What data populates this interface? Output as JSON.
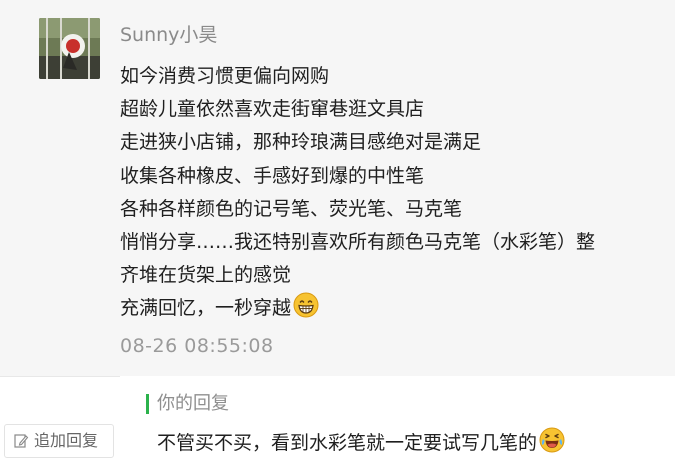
{
  "post": {
    "username": "Sunny小昊",
    "avatar_icon": "avatar-photo",
    "lines": [
      "如今消费习惯更偏向网购",
      "超龄儿童依然喜欢走街窜巷逛文具店",
      "走进狭小店铺，那种玲琅满目感绝对是满足",
      "收集各种橡皮、手感好到爆的中性笔",
      "各种各样颜色的记号笔、荧光笔、马克笔",
      "悄悄分享……我还特别喜欢所有颜色马克笔（水彩笔）整",
      "齐堆在货架上的感觉",
      "充满回忆，一秒穿越"
    ],
    "last_line_emoji": "grinning-face-emoji",
    "timestamp": "08-26 08:55:08"
  },
  "reply": {
    "label": "你的回复",
    "text": "不管买不买，看到水彩笔就一定要试写几笔的",
    "emoji": "laughing-tears-emoji",
    "accent_color": "#2bb24c"
  },
  "add_reply": {
    "label": "追加回复",
    "icon": "pen-icon"
  }
}
